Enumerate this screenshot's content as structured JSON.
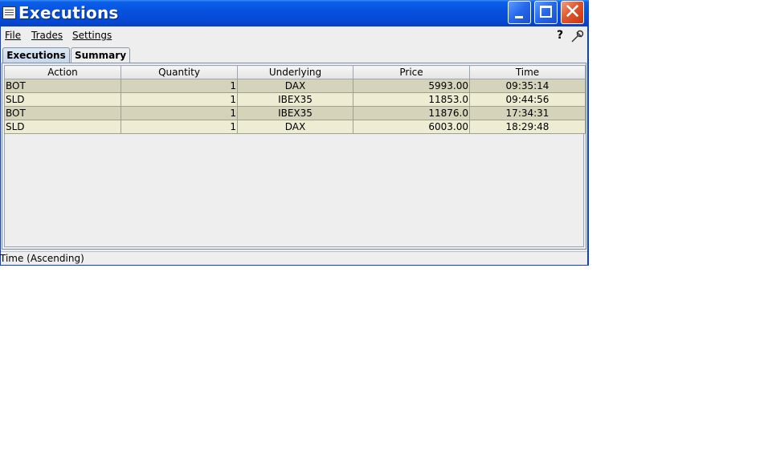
{
  "window": {
    "title": "Executions"
  },
  "menu": {
    "file": "File",
    "trades": "Trades",
    "settings": "Settings",
    "help": "?"
  },
  "tabs": [
    {
      "label": "Executions",
      "active": true
    },
    {
      "label": "Summary",
      "active": false
    }
  ],
  "table": {
    "columns": [
      "Action",
      "Quantity",
      "Underlying",
      "Price",
      "Time"
    ],
    "rows": [
      [
        "BOT",
        "1",
        "DAX",
        "5993.00",
        "09:35:14"
      ],
      [
        "SLD",
        "1",
        "IBEX35",
        "11853.0",
        "09:44:56"
      ],
      [
        "BOT",
        "1",
        "IBEX35",
        "11876.0",
        "17:34:31"
      ],
      [
        "SLD",
        "1",
        "DAX",
        "6003.00",
        "18:29:48"
      ]
    ]
  },
  "status": {
    "text": "Time (Ascending)"
  },
  "colors": {
    "row_dark": "#d6d3bb",
    "row_light": "#efecd4",
    "titlebar": "#0549d4",
    "close_button": "#e0542c"
  }
}
